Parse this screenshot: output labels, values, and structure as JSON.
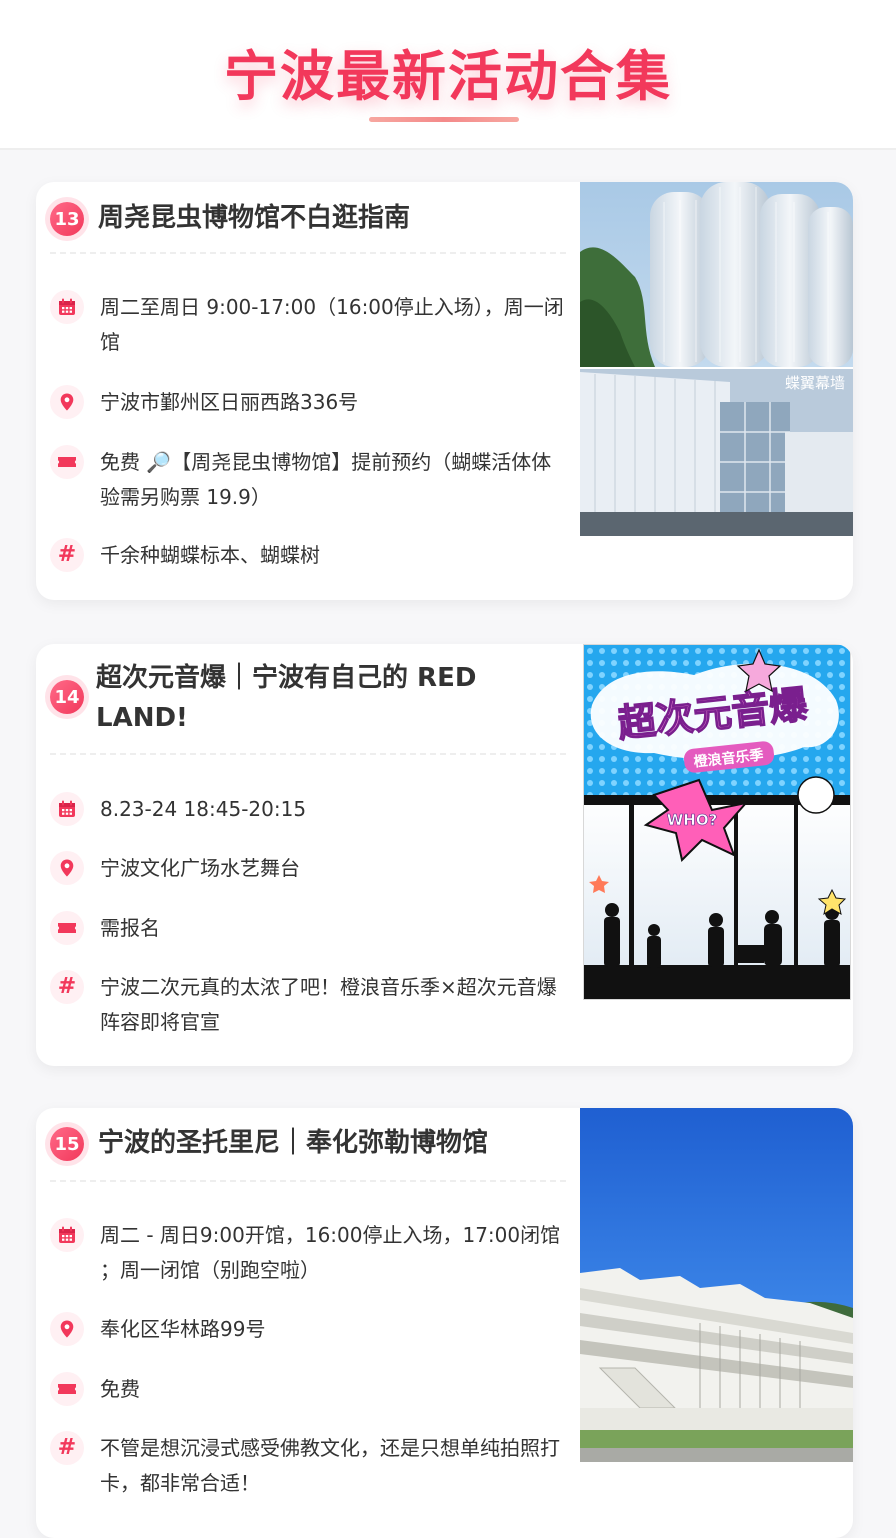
{
  "header": {
    "title": "宁波最新活动合集"
  },
  "cards": [
    {
      "number": "13",
      "title": "周尧昆虫博物馆不白逛指南",
      "hours": "周二至周日 9:00-17:00（16:00停止入场），周一闭馆",
      "address": "宁波市鄞州区日丽西路336号",
      "ticket": "免费 🔎【周尧昆虫博物馆】提前预约（蝴蝶活体体验需另购票 19.9）",
      "tags": "千余种蝴蝶标本、蝴蝶树",
      "image_caption": "蝶翼幕墙"
    },
    {
      "number": "14",
      "title": "超次元音爆｜宁波有自己的 RED LAND!",
      "hours": "8.23-24 18:45-20:15",
      "address": "宁波文化广场水艺舞台",
      "ticket": "需报名",
      "tags": "宁波二次元真的太浓了吧！橙浪音乐季×超次元音爆阵容即将官宣",
      "poster_title": "超次元音爆",
      "poster_subtitle": "橙浪音乐季",
      "poster_burst": "WHO?"
    },
    {
      "number": "15",
      "title": "宁波的圣托里尼｜奉化弥勒博物馆",
      "hours": "周二 - 周日9:00开馆，16:00停止入场，17:00闭馆 ；周一闭馆（别跑空啦）",
      "address": "奉化区华林路99号",
      "ticket": "免费",
      "tags": "不管是想沉浸式感受佛教文化，还是只想单纯拍照打卡，都非常合适！"
    }
  ],
  "colors": {
    "accent": "#f2385b",
    "accent_soft": "#fff0f3"
  },
  "icons": [
    "calendar-icon",
    "location-pin-icon",
    "ticket-icon",
    "hashtag-icon"
  ]
}
